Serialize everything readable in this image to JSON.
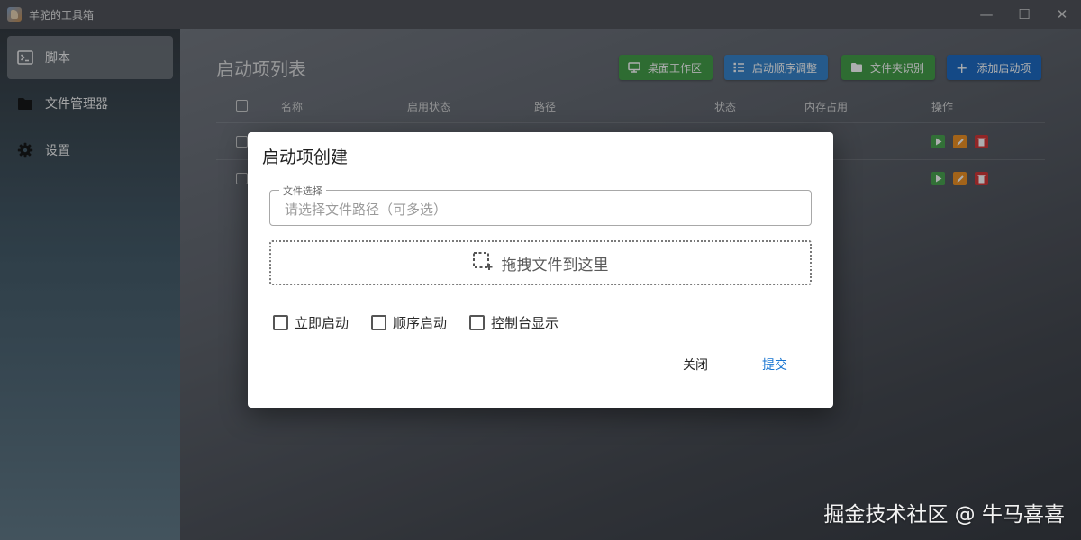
{
  "titlebar": {
    "app_title": "羊驼的工具箱",
    "minimize": "—",
    "maximize": "☐",
    "close": "✕"
  },
  "sidebar": {
    "items": [
      {
        "label": "脚本",
        "icon": "terminal-icon"
      },
      {
        "label": "文件管理器",
        "icon": "folder-icon"
      },
      {
        "label": "设置",
        "icon": "gear-icon"
      }
    ]
  },
  "main": {
    "title": "启动项列表",
    "toolbar": {
      "desktop_workspace": "桌面工作区",
      "startup_order": "启动顺序调整",
      "folder_recognize": "文件夹识别",
      "add_startup": "添加启动项",
      "add_plus": "+"
    },
    "table": {
      "headers": [
        "名称",
        "启用状态",
        "路径",
        "状态",
        "内存占用",
        "操作"
      ],
      "row_count": 2
    }
  },
  "dialog": {
    "title": "启动项创建",
    "file_field": {
      "legend": "文件选择",
      "placeholder": "请选择文件路径（可多选）"
    },
    "dropzone": {
      "label": "拖拽文件到这里"
    },
    "checkboxes": [
      "立即启动",
      "顺序启动",
      "控制台显示"
    ],
    "close_button": "关闭",
    "submit_button": "提交"
  },
  "colors": {
    "green_button": "#3d9a3f",
    "blue_button": "#2f7fc8",
    "primary_button": "#1565c0",
    "submit_text": "#1976d2",
    "play": "#43a047",
    "edit": "#ef8c1a",
    "delete": "#d32f2f"
  },
  "watermark": "掘金技术社区 @ 牛马喜喜"
}
